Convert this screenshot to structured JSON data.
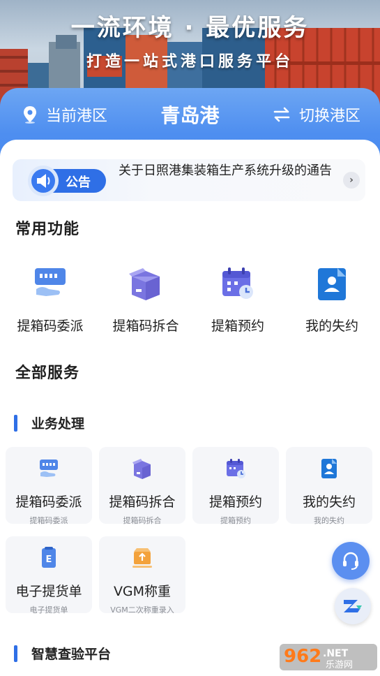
{
  "banner": {
    "title": "一流环境 · 最优服务",
    "subtitle": "打造一站式港口服务平台"
  },
  "port": {
    "current_label": "当前港区",
    "name": "青岛港",
    "switch_label": "切换港区"
  },
  "notice": {
    "badge": "公告",
    "text": "关于日照港集装箱生产系统升级的通告"
  },
  "common": {
    "title": "常用功能",
    "items": [
      {
        "label": "提箱码委派",
        "icon": "ticket-icon"
      },
      {
        "label": "提箱码拆合",
        "icon": "box-icon"
      },
      {
        "label": "提箱预约",
        "icon": "calendar-icon"
      },
      {
        "label": "我的失约",
        "icon": "user-doc-icon"
      }
    ]
  },
  "all_services": {
    "title": "全部服务",
    "business": {
      "title": "业务处理",
      "cards": [
        {
          "label": "提箱码委派",
          "sub": "提箱码委派"
        },
        {
          "label": "提箱码拆合",
          "sub": "提箱码拆合"
        },
        {
          "label": "提箱预约",
          "sub": "提箱预约"
        },
        {
          "label": "我的失约",
          "sub": "我的失约"
        },
        {
          "label": "电子提货单",
          "sub": "电子提货单"
        },
        {
          "label": "VGM称重",
          "sub": "VGM二次称重录入"
        }
      ]
    },
    "inspection": {
      "title": "智慧查验平台"
    }
  },
  "watermark": {
    "text": "962.NET",
    "sub": "乐游网"
  },
  "colors": {
    "accent": "#4a8aee",
    "badge": "#2f6fe6"
  }
}
